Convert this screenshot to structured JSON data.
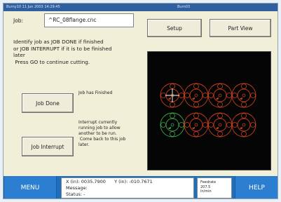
{
  "titlebar": {
    "left_text": "Burny10    11 Jun 2003  14:29:45",
    "right_text": "Burn03"
  },
  "job": {
    "label": "Job:",
    "value": "^RC_08flange.cnc"
  },
  "buttons": {
    "setup": "Setup",
    "part_view": "Part View",
    "job_done": "Job Done",
    "job_interrupt": "Job Interrupt",
    "menu": "MENU",
    "help": "HELP"
  },
  "message": {
    "line1": "Identify job as JOB DONE if finished",
    "line2": "or JOB INTERRUPT if it is to be finished",
    "line3": "later",
    "line4": " Press GO to continue cutting."
  },
  "notes": {
    "job_done_note": "Job has Finished",
    "interrupt_note": [
      "Interrupt currently",
      "running job to allow",
      "another to be run.",
      " Come back to this job",
      "later."
    ]
  },
  "status": {
    "x_label": "X (in):",
    "x_value": "0035.7900",
    "y_label": "Y (in):",
    "y_value": "-010.7671",
    "message_label": "Message:",
    "status_label": "Status:",
    "status_value": "-"
  },
  "feedrate": {
    "label": "Feedrate",
    "value": "207.5",
    "unit": "in/min"
  },
  "colors": {
    "accent": "#1f6fbf",
    "part_done": "#3ea84a",
    "part_pending": "#c8401f",
    "view_bg": "#050505"
  },
  "part_view": {
    "parts": [
      {
        "row": 1,
        "col": 1,
        "state": "pending"
      },
      {
        "row": 1,
        "col": 2,
        "state": "pending"
      },
      {
        "row": 1,
        "col": 3,
        "state": "pending"
      },
      {
        "row": 1,
        "col": 4,
        "state": "pending"
      },
      {
        "row": 2,
        "col": 1,
        "state": "done"
      },
      {
        "row": 2,
        "col": 2,
        "state": "pending"
      },
      {
        "row": 2,
        "col": 3,
        "state": "pending"
      },
      {
        "row": 2,
        "col": 4,
        "state": "pending"
      }
    ],
    "cursor_part": {
      "row": 1,
      "col": 1
    }
  }
}
